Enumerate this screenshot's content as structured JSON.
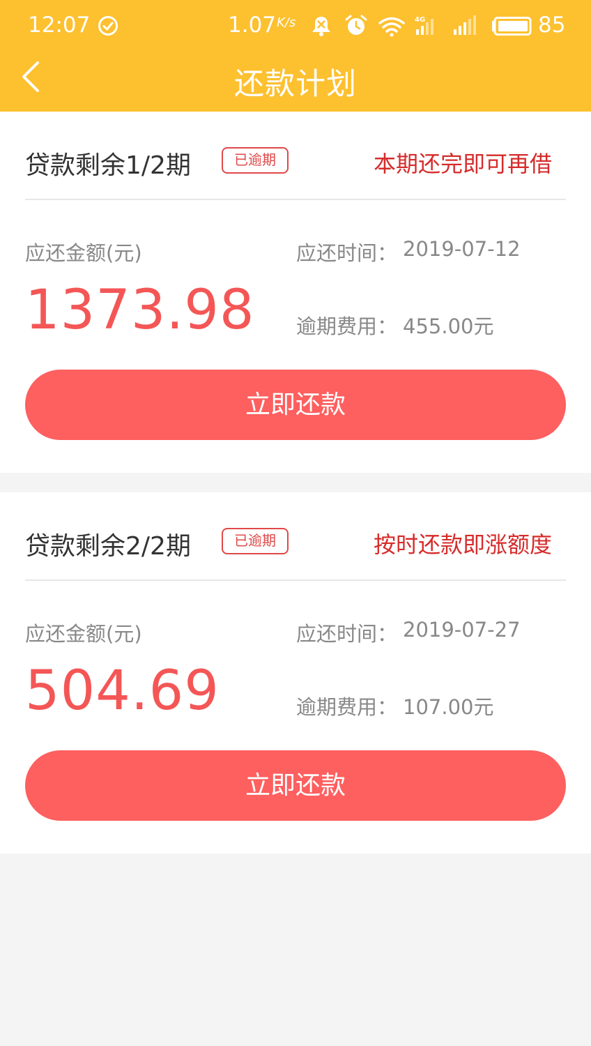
{
  "status_bar": {
    "time": "12:07",
    "net_speed": "1.07",
    "net_unit": "K/s",
    "battery": "85",
    "icons": [
      "check-circle-icon",
      "mute-bell-icon",
      "alarm-icon",
      "wifi-icon",
      "signal-4g-icon",
      "signal-icon",
      "battery-icon"
    ]
  },
  "header": {
    "title": "还款计划",
    "back_icon": "chevron-left-icon",
    "background": "#fdc02f"
  },
  "plans": [
    {
      "title": "贷款剩余1/2期",
      "badge": "已逾期",
      "tip": "本期还完即可再借",
      "amount_label": "应还金额(元)",
      "amount": "1373.98",
      "date_label": "应还时间：",
      "date": "2019-07-12",
      "fee_label": "逾期费用：",
      "fee": "455.00元",
      "button": "立即还款"
    },
    {
      "title": "贷款剩余2/2期",
      "badge": "已逾期",
      "tip": "按时还款即涨额度",
      "amount_label": "应还金额(元)",
      "amount": "504.69",
      "date_label": "应还时间：",
      "date": "2019-07-27",
      "fee_label": "逾期费用：",
      "fee": "107.00元",
      "button": "立即还款"
    }
  ],
  "colors": {
    "accent": "#fe5f5f",
    "amount": "#f45656",
    "tip": "#d62b2b",
    "page_bg": "#f4f4f4"
  }
}
